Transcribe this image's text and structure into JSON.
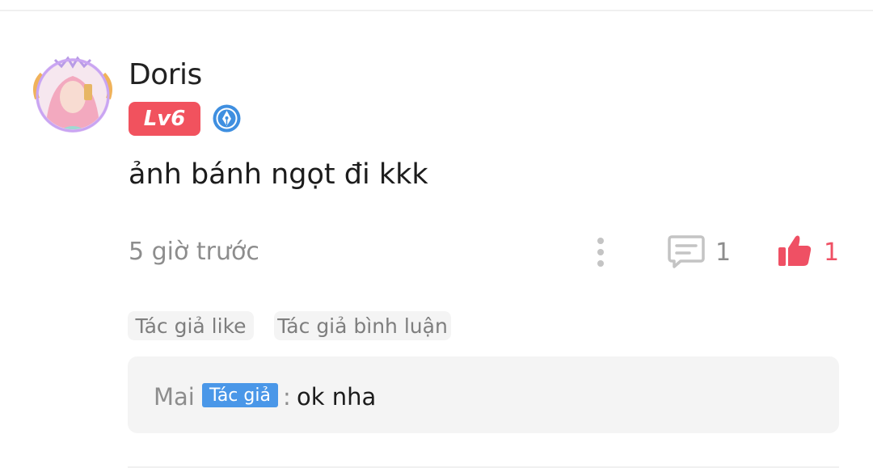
{
  "comment": {
    "username": "Doris",
    "level": "Lv6",
    "text": "ảnh bánh ngọt đi kkk",
    "time": "5 giờ trước",
    "reply_count": "1",
    "like_count": "1",
    "tags": [
      "Tác giả like",
      "Tác giả bình luận"
    ]
  },
  "reply": {
    "author": "Mai",
    "author_badge": "Tác giả",
    "separator": ":",
    "text": "ok nha"
  },
  "icons": {
    "avatar": "avatar-image",
    "badge": "pen-nib-icon",
    "more": "more-vertical-icon",
    "reply": "comment-icon",
    "like": "thumbs-up-icon"
  },
  "colors": {
    "level_badge": "#f1525e",
    "like": "#ef5064",
    "author_badge": "#4a97e8"
  }
}
